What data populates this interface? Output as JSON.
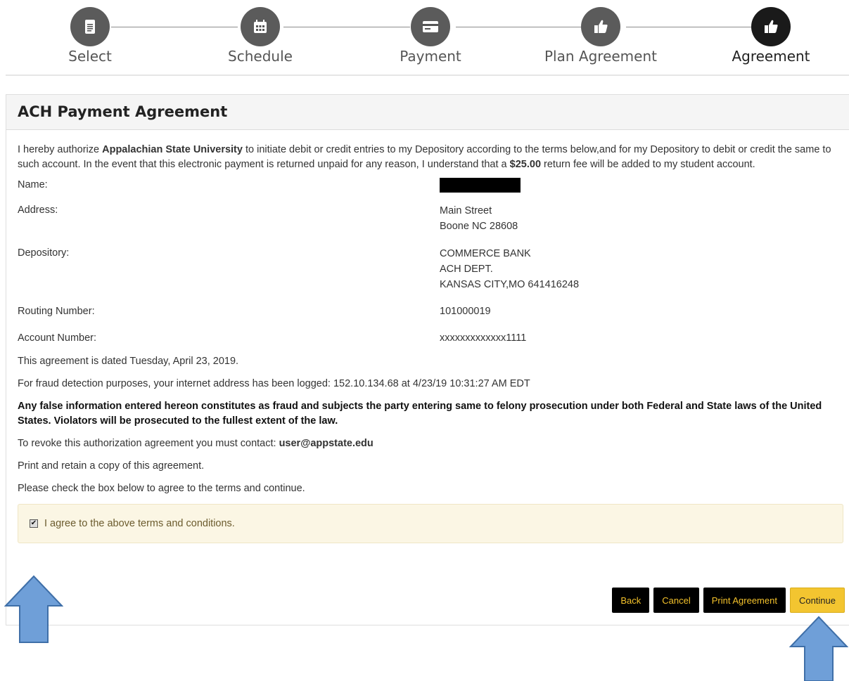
{
  "steps": [
    {
      "label": "Select",
      "icon": "document-icon"
    },
    {
      "label": "Schedule",
      "icon": "calendar-icon"
    },
    {
      "label": "Payment",
      "icon": "credit-card-icon"
    },
    {
      "label": "Plan Agreement",
      "icon": "thumbs-up-icon"
    },
    {
      "label": "Agreement",
      "icon": "thumbs-up-icon"
    }
  ],
  "panel": {
    "title": "ACH Payment Agreement",
    "intro": {
      "part1": "I hereby authorize ",
      "university": "Appalachian State University",
      "part2": " to initiate debit or credit entries to my Depository according to the terms below,and for my Depository to debit or credit the same to such account. In the event that this electronic payment is returned unpaid for any reason, I understand that a ",
      "fee": "$25.00",
      "part3": " return fee will be added to my student account."
    },
    "fields": {
      "name_label": "Name:",
      "address_label": "Address:",
      "address_line1": "Main Street",
      "address_line2": "Boone NC 28608",
      "depository_label": "Depository:",
      "depository_line1": "COMMERCE BANK",
      "depository_line2": "ACH DEPT.",
      "depository_line3": "KANSAS CITY,MO 641416248",
      "routing_label": "Routing Number:",
      "routing_value": "101000019",
      "account_label": "Account Number:",
      "account_value": "xxxxxxxxxxxxx1111"
    },
    "dated": "This agreement is dated Tuesday, April 23, 2019.",
    "fraud_log": "For fraud detection purposes, your internet address has been logged: 152.10.134.68 at 4/23/19 10:31:27 AM EDT",
    "warning": "Any false information entered hereon constitutes as fraud and subjects the party entering same to felony prosecution under both Federal and State laws of the United States. Violators will be prosecuted to the fullest extent of the law.",
    "revoke_text": "To revoke this authorization agreement you must contact: ",
    "revoke_email": "user@appstate.edu",
    "print_note": "Print and retain a copy of this agreement.",
    "check_note": "Please check the box below to agree to the terms and continue.",
    "agree_label": "I agree to the above terms and conditions.",
    "agree_checked": true
  },
  "buttons": {
    "back": "Back",
    "cancel": "Cancel",
    "print": "Print Agreement",
    "continue": "Continue"
  },
  "colors": {
    "accent": "#f3c530",
    "arrow": "#6f9fd8",
    "agree_bg": "#fbf6e4"
  }
}
